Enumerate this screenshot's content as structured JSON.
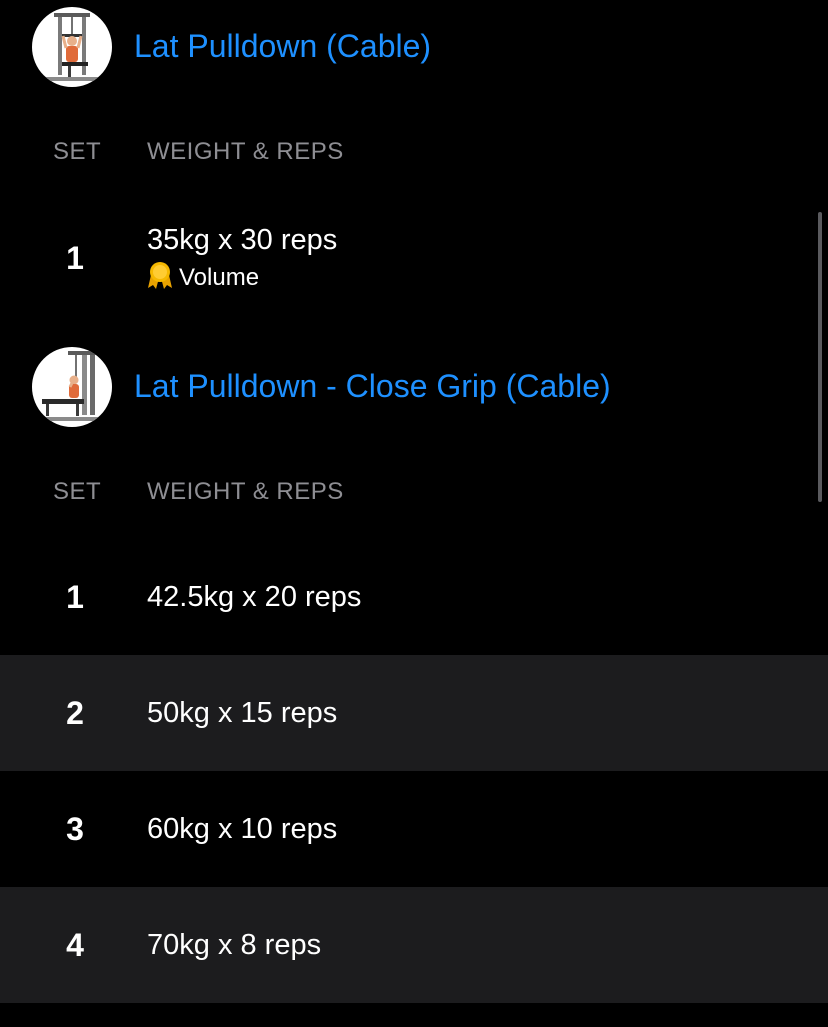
{
  "colors": {
    "background": "#000000",
    "alt_row": "#1c1c1e",
    "accent": "#1e90ff",
    "muted": "#8e8e93",
    "medal": "#f5b800"
  },
  "exercises": [
    {
      "title": "Lat Pulldown (Cable)",
      "thumbnail_icon": "lat-pulldown-icon",
      "set_header": "SET",
      "weight_header": "WEIGHT & REPS",
      "sets": [
        {
          "num": "1",
          "value": "35kg x 30 reps",
          "badge": {
            "icon": "medal-icon",
            "label": "Volume"
          }
        }
      ]
    },
    {
      "title": "Lat Pulldown - Close Grip (Cable)",
      "thumbnail_icon": "lat-pulldown-close-grip-icon",
      "set_header": "SET",
      "weight_header": "WEIGHT & REPS",
      "sets": [
        {
          "num": "1",
          "value": "42.5kg x 20 reps"
        },
        {
          "num": "2",
          "value": "50kg x 15 reps"
        },
        {
          "num": "3",
          "value": "60kg x 10 reps"
        },
        {
          "num": "4",
          "value": "70kg x 8 reps"
        }
      ]
    }
  ]
}
